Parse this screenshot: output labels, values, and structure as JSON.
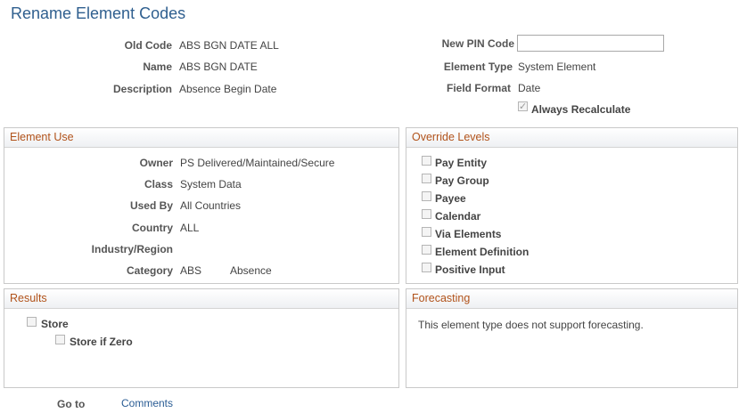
{
  "page": {
    "title": "Rename Element Codes"
  },
  "header": {
    "old_code_label": "Old Code",
    "old_code_value": "ABS BGN DATE ALL",
    "name_label": "Name",
    "name_value": "ABS BGN DATE",
    "description_label": "Description",
    "description_value": "Absence Begin Date",
    "new_pin_label": "New PIN Code",
    "new_pin_value": "",
    "element_type_label": "Element Type",
    "element_type_value": "System Element",
    "field_format_label": "Field Format",
    "field_format_value": "Date",
    "always_recalculate_label": "Always Recalculate",
    "always_recalculate_checked": true
  },
  "element_use": {
    "title": "Element Use",
    "owner_label": "Owner",
    "owner_value": "PS Delivered/Maintained/Secure",
    "class_label": "Class",
    "class_value": "System Data",
    "used_by_label": "Used By",
    "used_by_value": "All Countries",
    "country_label": "Country",
    "country_value": "ALL",
    "industry_label": "Industry/Region",
    "industry_value": "",
    "category_label": "Category",
    "category_code": "ABS",
    "category_desc": "Absence"
  },
  "override_levels": {
    "title": "Override Levels",
    "items": [
      {
        "label": "Pay Entity",
        "checked": false
      },
      {
        "label": "Pay Group",
        "checked": false
      },
      {
        "label": "Payee",
        "checked": false
      },
      {
        "label": "Calendar",
        "checked": false
      },
      {
        "label": "Via Elements",
        "checked": false
      },
      {
        "label": "Element Definition",
        "checked": false
      },
      {
        "label": "Positive Input",
        "checked": false
      }
    ]
  },
  "results": {
    "title": "Results",
    "store_label": "Store",
    "store_checked": false,
    "store_if_zero_label": "Store if Zero",
    "store_if_zero_checked": false
  },
  "forecasting": {
    "title": "Forecasting",
    "message": "This element type does not support forecasting."
  },
  "footer": {
    "goto_label": "Go to",
    "comments_link": "Comments"
  }
}
